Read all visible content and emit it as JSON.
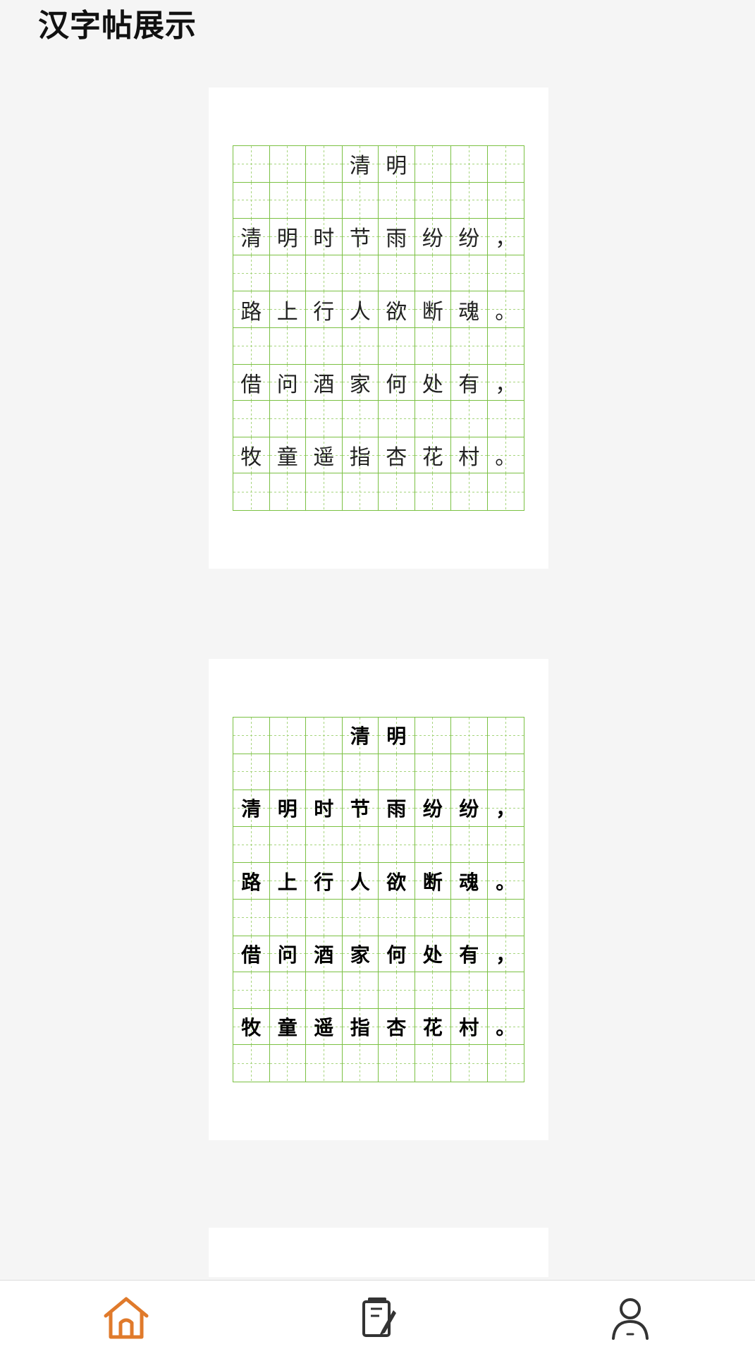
{
  "header": {
    "title": "汉字帖展示"
  },
  "cards": [
    {
      "style": "regular",
      "grid": [
        [
          "",
          "",
          "",
          "清",
          "明",
          "",
          "",
          ""
        ],
        [
          "",
          "",
          "",
          "",
          "",
          "",
          "",
          ""
        ],
        [
          "清",
          "明",
          "时",
          "节",
          "雨",
          "纷",
          "纷",
          "，"
        ],
        [
          "",
          "",
          "",
          "",
          "",
          "",
          "",
          ""
        ],
        [
          "路",
          "上",
          "行",
          "人",
          "欲",
          "断",
          "魂",
          "。"
        ],
        [
          "",
          "",
          "",
          "",
          "",
          "",
          "",
          ""
        ],
        [
          "借",
          "问",
          "酒",
          "家",
          "何",
          "处",
          "有",
          "，"
        ],
        [
          "",
          "",
          "",
          "",
          "",
          "",
          "",
          ""
        ],
        [
          "牧",
          "童",
          "遥",
          "指",
          "杏",
          "花",
          "村",
          "。"
        ],
        [
          "",
          "",
          "",
          "",
          "",
          "",
          "",
          ""
        ]
      ]
    },
    {
      "style": "calligraphy",
      "grid": [
        [
          "",
          "",
          "",
          "清",
          "明",
          "",
          "",
          ""
        ],
        [
          "",
          "",
          "",
          "",
          "",
          "",
          "",
          ""
        ],
        [
          "清",
          "明",
          "时",
          "节",
          "雨",
          "纷",
          "纷",
          "，"
        ],
        [
          "",
          "",
          "",
          "",
          "",
          "",
          "",
          ""
        ],
        [
          "路",
          "上",
          "行",
          "人",
          "欲",
          "断",
          "魂",
          "。"
        ],
        [
          "",
          "",
          "",
          "",
          "",
          "",
          "",
          ""
        ],
        [
          "借",
          "问",
          "酒",
          "家",
          "何",
          "处",
          "有",
          "，"
        ],
        [
          "",
          "",
          "",
          "",
          "",
          "",
          "",
          ""
        ],
        [
          "牧",
          "童",
          "遥",
          "指",
          "杏",
          "花",
          "村",
          "。"
        ],
        [
          "",
          "",
          "",
          "",
          "",
          "",
          "",
          ""
        ]
      ]
    }
  ],
  "colors": {
    "grid_line": "#7bc143",
    "nav_active": "#e07a2b",
    "nav_inactive": "#333333"
  },
  "bottom_nav": [
    {
      "icon": "home-icon",
      "active": true
    },
    {
      "icon": "copybook-icon",
      "active": false
    },
    {
      "icon": "profile-icon",
      "active": false
    }
  ]
}
